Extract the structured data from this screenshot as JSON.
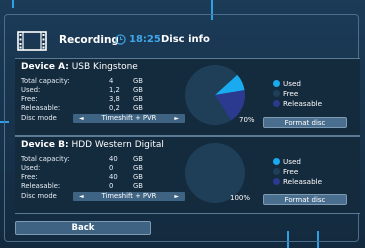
{
  "header": {
    "title": "Recording",
    "time": "18:25",
    "subtitle": "Disc info"
  },
  "device_a": {
    "label": "Device A:",
    "name": "USB Kingstone",
    "rows": [
      {
        "label": "Total capacity:",
        "value": "4",
        "unit": "GB"
      },
      {
        "label": "Used:",
        "value": "1,2",
        "unit": "GB"
      },
      {
        "label": "Free:",
        "value": "3,8",
        "unit": "GB"
      },
      {
        "label": "Releasable:",
        "value": "0,2",
        "unit": "GB"
      }
    ],
    "disc_mode_label": "Disc mode",
    "disc_mode_value": "Timeshift + PVR",
    "usage_percent": "70%",
    "format_label": "Format disc"
  },
  "device_b": {
    "label": "Device B:",
    "name": "HDD Western Digital",
    "rows": [
      {
        "label": "Total capacity:",
        "value": "40",
        "unit": "GB"
      },
      {
        "label": "Used:",
        "value": "0",
        "unit": "GB"
      },
      {
        "label": "Free:",
        "value": "40",
        "unit": "GB"
      },
      {
        "label": "Releasable:",
        "value": "0",
        "unit": "GB"
      }
    ],
    "disc_mode_label": "Disc mode",
    "disc_mode_value": "Timeshift + PVR",
    "usage_percent": "100%",
    "format_label": "Format disc"
  },
  "legend": {
    "used": "Used",
    "free": "Free",
    "releasable": "Releasable"
  },
  "back_label": "Back",
  "icons": {
    "film": "film-icon",
    "clock": "clock-icon",
    "arrow_left": "◄",
    "arrow_right": "►"
  },
  "colors": {
    "used": "#19aaf0",
    "free": "#1f3f58",
    "releasable": "#2b3a8f",
    "accent": "#3fa7e9"
  }
}
